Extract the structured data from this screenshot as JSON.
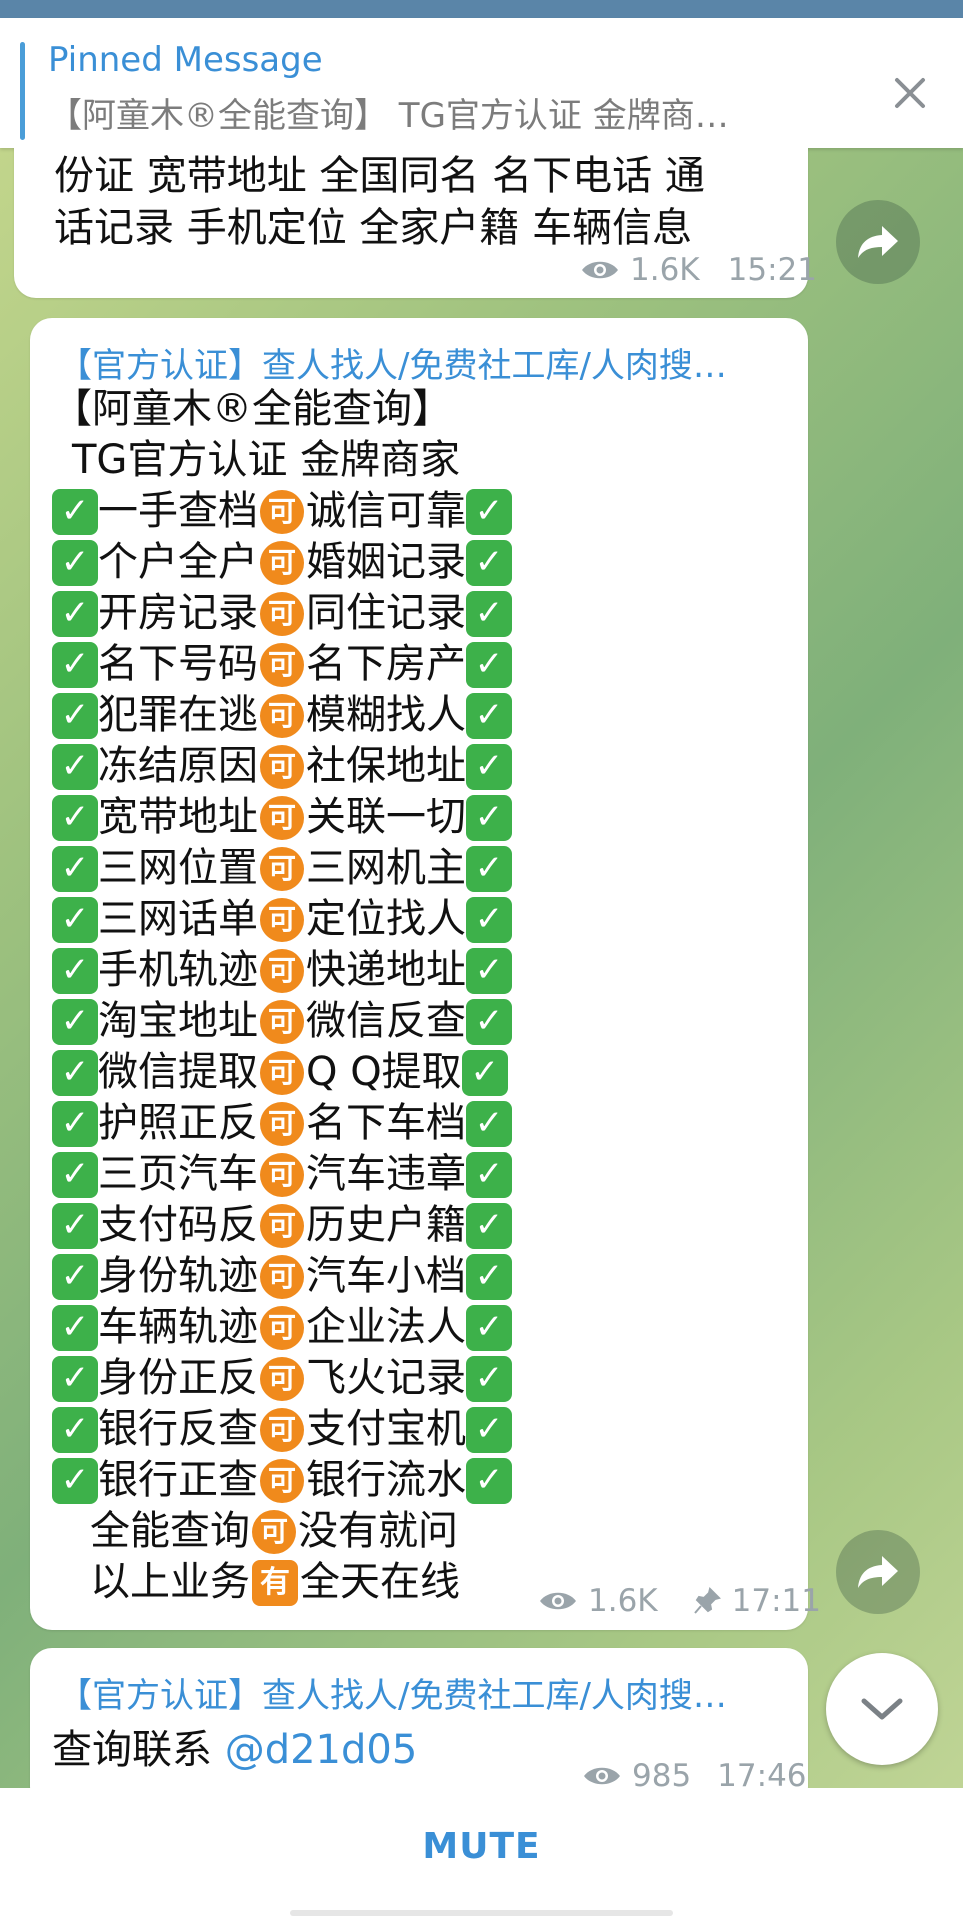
{
  "pinned": {
    "title": "Pinned Message",
    "text": "【阿童木®全能查询】   TG官方认证 金牌商…"
  },
  "message1": {
    "text_line1": "份证 宽带地址 全国同名 名下电话 通",
    "text_line2": "话记录 手机定位 全家户籍 车辆信息",
    "views": "1.6K",
    "time": "15:21"
  },
  "message2": {
    "sender": "【官方认证】查人找人/免费社工库/人肉搜…",
    "header1": "【阿童木®全能查询】",
    "header2": " TG官方认证 金牌商家",
    "rows": [
      {
        "left": "一手查档",
        "right": "诚信可靠"
      },
      {
        "left": "个户全户",
        "right": "婚姻记录"
      },
      {
        "left": "开房记录",
        "right": "同住记录"
      },
      {
        "left": "名下号码",
        "right": "名下房产"
      },
      {
        "left": "犯罪在逃",
        "right": "模糊找人"
      },
      {
        "left": "冻结原因",
        "right": "社保地址"
      },
      {
        "left": "宽带地址",
        "right": "关联一切"
      },
      {
        "left": "三网位置",
        "right": "三网机主"
      },
      {
        "left": "三网话单",
        "right": "定位找人"
      },
      {
        "left": "手机轨迹",
        "right": "快递地址"
      },
      {
        "left": "淘宝地址",
        "right": "微信反查"
      },
      {
        "left": "微信提取",
        "right": "Q Q提取"
      },
      {
        "left": "护照正反",
        "right": "名下车档"
      },
      {
        "left": "三页汽车",
        "right": "汽车违章"
      },
      {
        "left": "支付码反",
        "right": "历史户籍"
      },
      {
        "left": "身份轨迹",
        "right": "汽车小档"
      },
      {
        "left": "车辆轨迹",
        "right": "企业法人"
      },
      {
        "left": "身份正反",
        "right": "飞火记录"
      },
      {
        "left": "银行反查",
        "right": "支付宝机"
      },
      {
        "left": "银行正查",
        "right": "银行流水"
      }
    ],
    "footer1_left": "全能查询",
    "footer1_right": "没有就问",
    "footer2_left": "以上业务",
    "footer2_right": "全天在线",
    "ke_glyph": "可",
    "you_glyph": "有",
    "check_glyph": "✓",
    "views": "1.6K",
    "time": "17:11"
  },
  "message3": {
    "sender": "【官方认证】查人找人/免费社工库/人肉搜…",
    "text": "查询联系 ",
    "mention": "@d21d05",
    "views": "985",
    "time": "17:46"
  },
  "bottom": {
    "mute_label": "MUTE"
  },
  "colors": {
    "accent": "#3a8fd6",
    "check_green": "#3db14a",
    "ke_orange": "#f08a1c"
  },
  "icons": [
    "close-icon",
    "eye-icon",
    "forward-icon",
    "pin-icon",
    "chevron-down-icon"
  ]
}
